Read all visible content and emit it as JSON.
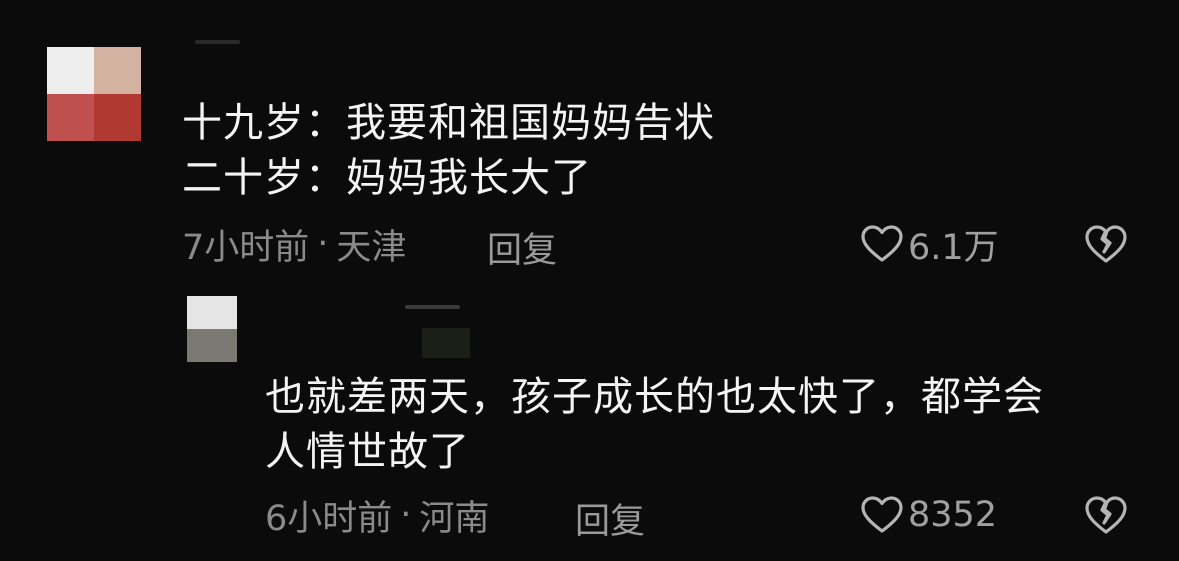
{
  "comments": [
    {
      "lines": [
        "十九岁：我要和祖国妈妈告状",
        "二十岁：妈妈我长大了"
      ],
      "time": "7小时前",
      "location": "天津",
      "reply_label": "回复",
      "likes": "6.1万",
      "avatar_colors": [
        "#eeeeee",
        "#d4b2a2",
        "#c0504d",
        "#b03a32"
      ]
    },
    {
      "lines": [
        "也就差两天，孩子成长的也太快了，都学会",
        "人情世故了"
      ],
      "time": "6小时前",
      "location": "河南",
      "reply_label": "回复",
      "likes": "8352",
      "avatar_colors": [
        "#e6e6e6",
        "#e6e6e6",
        "#7a7a72",
        "#7a7a72"
      ]
    }
  ],
  "separator": "·",
  "colors": {
    "background": "#0b0b0b",
    "text": "#f4f4f4",
    "meta": "#8a8a8a",
    "icon": "#b5b5b5"
  },
  "icons": {
    "like": "heart-outline-icon",
    "dislike": "broken-heart-icon"
  }
}
